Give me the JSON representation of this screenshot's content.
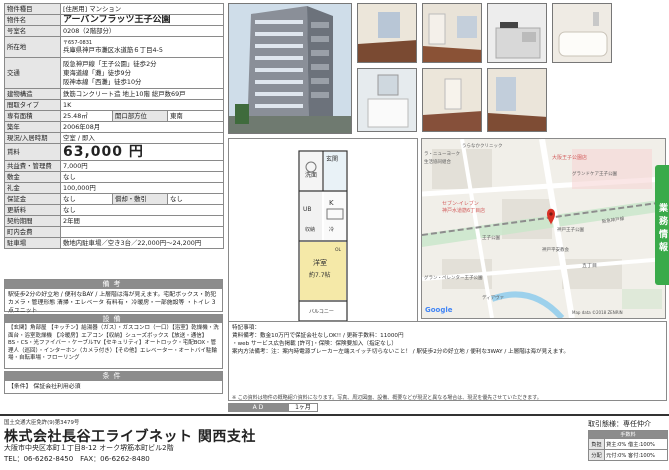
{
  "spec": {
    "type_label": "物件種目",
    "type_value": "[住居用] マンション",
    "name_label": "物件名",
    "name_value": "アーバンフラッツ王子公園",
    "room_label": "号室名",
    "room_value": "0208（2階部分）",
    "location_label": "所在地",
    "zip": "〒657-0831",
    "address": "兵庫県神戸市灘区水道筋６丁目4-5",
    "transport_label": "交通",
    "transport_lines": [
      "阪急神戸線「王子公園」徒歩2分",
      "東海道線「灘」徒歩9分",
      "阪神本線「西灘」徒歩10分"
    ],
    "structure_label": "建物構造",
    "structure_value": "鉄筋コンクリート造 地上10階 総戸数69戸",
    "layout_label": "間取タイプ",
    "layout_value": "1K",
    "area_label": "専有面積",
    "area_value": "25.48㎡",
    "facing_label": "開口部方位",
    "facing_value": "東南",
    "built_label": "築年",
    "built_value": "2006年08月",
    "status_label": "現況/入居時期",
    "status_value": "空室 / 即入",
    "rent_label": "賃料",
    "rent_value": "63,000 円",
    "fee_label": "共益費・管理費",
    "fee_value": "7,000円",
    "deposit_label": "敷金",
    "deposit_value": "なし",
    "keymoney_label": "礼金",
    "keymoney_value": "100,000円",
    "guarantee_label": "保証金",
    "guarantee_value": "なし",
    "shikibiki_label": "償却・敷引",
    "shikibiki_value": "なし",
    "renewal_label": "更新料",
    "renewal_value": "なし",
    "contract_label": "契約期間",
    "contract_value": "2年間",
    "insurance_label": "町内会費",
    "insurance_value": "",
    "parking_label": "駐車場",
    "parking_value": "敷地内駐車場／空き3台／22,000円〜24,200円"
  },
  "notes": {
    "title": "備考",
    "text": "駅徒歩2分の好立地 / 便利なBAY / 上層階は海が見えます。宅配ボックス・防犯カメラ・管理形態 清掃・エレベータ 有料有・ 冷暖房・一部施設等 ・トイレ 3点ユニット"
  },
  "equipment": {
    "title": "設備",
    "text": "【玄関】角部屋 【キッチン】給湯器（ガス）・ガスコンロ（一口）【浴室】乾燥機・洗面台・浴室乾燥機 【冷暖房】エアコン【収納】シューズボックス【放送・通信】BS・CS・光ファイバー・ケーブルTV【セキュリティ】オートロック・宅配BOX・管理人（巡回）・インターホン（カメラ付き）【その他】エレベーター・オートバイ駐輪場・自転車場・フローリング"
  },
  "conditions": {
    "title": "条件",
    "text": "【条件】 保証会社利用必須"
  },
  "floorplan": {
    "labels": [
      "洗面",
      "玄関",
      "UB",
      "K",
      "収納",
      "冷",
      "洋室",
      "約7.7帖",
      "バルコニー",
      "OL"
    ]
  },
  "map": {
    "labels": [
      "うらなかクリニック",
      "ラ・ニューヨーク",
      "生活協同組合",
      "大阪王子公園店",
      "グランドケア王子公園",
      "セブン‐イレブン",
      "神戸水道筋6丁目店",
      "神戸王子公園",
      "王子公園",
      "神戸平安教会",
      "五丁目",
      "グラン・ペレンター王子公園",
      "ディアヴァ",
      "Google",
      "Map data ©2018 ZENRIN"
    ],
    "road_label": "阪急神戸線"
  },
  "remarks": {
    "title": "特記事項：",
    "line1": "賃料備考：敷金10万円で保証会社なしOK!! / 更新手数料：11000円",
    "line2": "・web サービス広告掲載 [許可]・保険：保険要加入（指定なし）",
    "line3": "案内方法備考：注：案内時電源ブレーカー左端スイッチ切らないこと！ / 駅徒歩2分の好立地 / 便利な3WAY / 上層階は海が見えます。",
    "footnote": "※ この資料は物件の概略紹介資料になります。写真、周辺図面、設備、概要などが現況と異なる場合は、現況を優先させていただきます。"
  },
  "ad": {
    "label": "A D",
    "value": "1ヶ月"
  },
  "footer": {
    "license": "国土交通大臣免許(9)第3479号",
    "company": "株式会社長谷工ライブネット 関西支社",
    "address": "大阪市中央区本町１丁目8-12 オーク堺筋本町ビル2階",
    "phone": "TEL：06-6262-8450　FAX：06-6262-8480"
  },
  "deal": {
    "heading": "取引態様：専任仲介",
    "fee_header": "手数料",
    "row1_key": "負担",
    "row1_val": "貸主:0% 借主:100%",
    "row2_key": "分配",
    "row2_val": "元付:0% 客付:100%"
  },
  "side_tab": {
    "label": "業務情報"
  },
  "colors": {
    "label_bg": "#e6e6e6",
    "band_bg": "#8c8c8c",
    "side_tab": "#3aaa4a",
    "map_pin": "#d93025"
  }
}
